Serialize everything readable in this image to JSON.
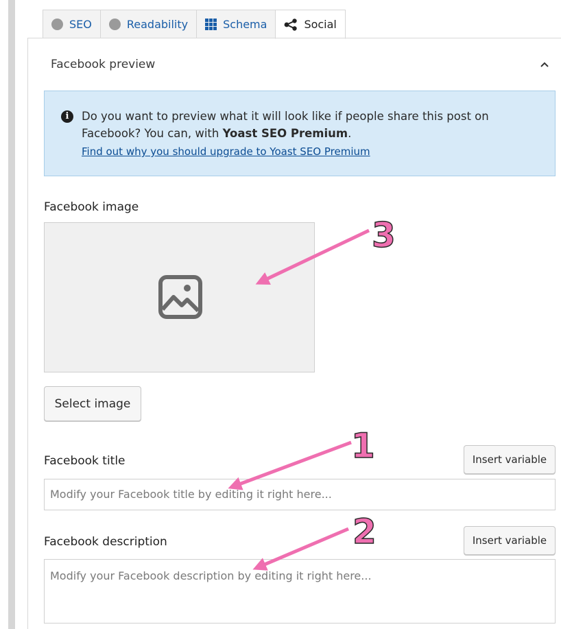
{
  "tabs": [
    {
      "label": "SEO",
      "icon": "gray-dot-icon"
    },
    {
      "label": "Readability",
      "icon": "gray-dot-icon"
    },
    {
      "label": "Schema",
      "icon": "grid-icon"
    },
    {
      "label": "Social",
      "icon": "share-icon",
      "active": true
    }
  ],
  "facebook_preview": {
    "title": "Facebook preview",
    "info": {
      "text": "Do you want to preview what it will look like if people share this post on Facebook? You can, with ",
      "bold": "Yoast SEO Premium",
      "suffix": ".",
      "link": "Find out why you should upgrade to Yoast SEO Premium"
    }
  },
  "facebook_image": {
    "label": "Facebook image",
    "select_button": "Select image"
  },
  "facebook_title": {
    "label": "Facebook title",
    "insert_button": "Insert variable",
    "placeholder": "Modify your Facebook title by editing it right here..."
  },
  "facebook_description": {
    "label": "Facebook description",
    "insert_button": "Insert variable",
    "placeholder": "Modify your Facebook description by editing it right here..."
  },
  "annotations": {
    "one": "1",
    "two": "2",
    "three": "3"
  },
  "colors": {
    "accent": "#1a5ea8",
    "info_bg": "#d7eaf8",
    "annotation": "#ef6fb0"
  }
}
